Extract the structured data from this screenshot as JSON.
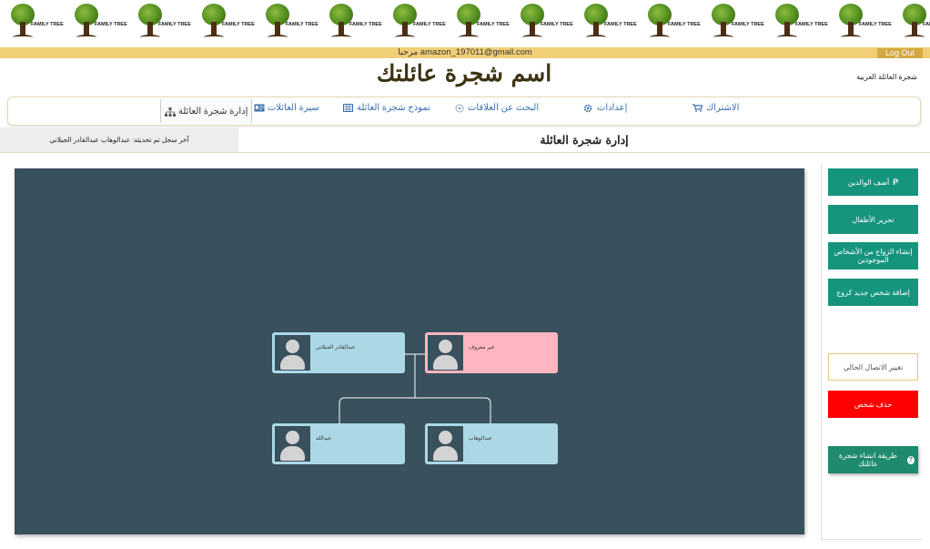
{
  "banner": {
    "logo_text": "FAMILY TREE",
    "count": 15
  },
  "topbar": {
    "welcome": "مرحبا amazon_197011@gmail.com",
    "logout": "Log Out"
  },
  "header": {
    "site_title": "اسم شجرة عائلتك",
    "language": "شجرة العائلة العربية"
  },
  "nav": {
    "items": [
      {
        "label": "الاشتراك",
        "icon": "cart-icon"
      },
      {
        "label": "إعدادات",
        "icon": "gear-icon"
      },
      {
        "label": "البحث عن العلاقات",
        "icon": "search-relations-icon"
      },
      {
        "label": "نموذج شجرة العائلة",
        "icon": "grid-icon"
      },
      {
        "label": "سيرة العائلات",
        "icon": "id-card-icon"
      },
      {
        "label": "إدارة شجرة العائلة",
        "icon": "org-chart-icon"
      }
    ]
  },
  "page": {
    "title": "إدارة شجرة العائلة",
    "last_updated": "آخر سجل تم تحديثه: عبدالوهاب عبدالقادر الجيلاني"
  },
  "tree": {
    "persons": [
      {
        "name": "عبدالقادر الجيلاني",
        "gender": "male"
      },
      {
        "name": "غير معروف",
        "gender": "female"
      },
      {
        "name": "عبدالله",
        "gender": "male"
      },
      {
        "name": "عبدالوهاب",
        "gender": "male"
      }
    ]
  },
  "sidebar": {
    "add_parents": "أضف الوالدين",
    "add_parents_icon": "P",
    "edit_children": "تحرير الأطفال",
    "create_marriage": "إنشاء الزواج من الأشخاص الموجودين",
    "add_new_spouse": "إضافة شخص جديد كزوج",
    "change_connection": "تغيير الاتصال الحالي",
    "delete_person": "حذف شخص",
    "help": "طريقة انشاء شجرة عائلتك",
    "help_icon": "?"
  },
  "colors": {
    "canvas": "#39505d",
    "male": "#acd8e6",
    "female": "#ffb6c1",
    "green_button": "#16957d",
    "red_button": "#ff0000",
    "topbar": "#f1cf77"
  }
}
